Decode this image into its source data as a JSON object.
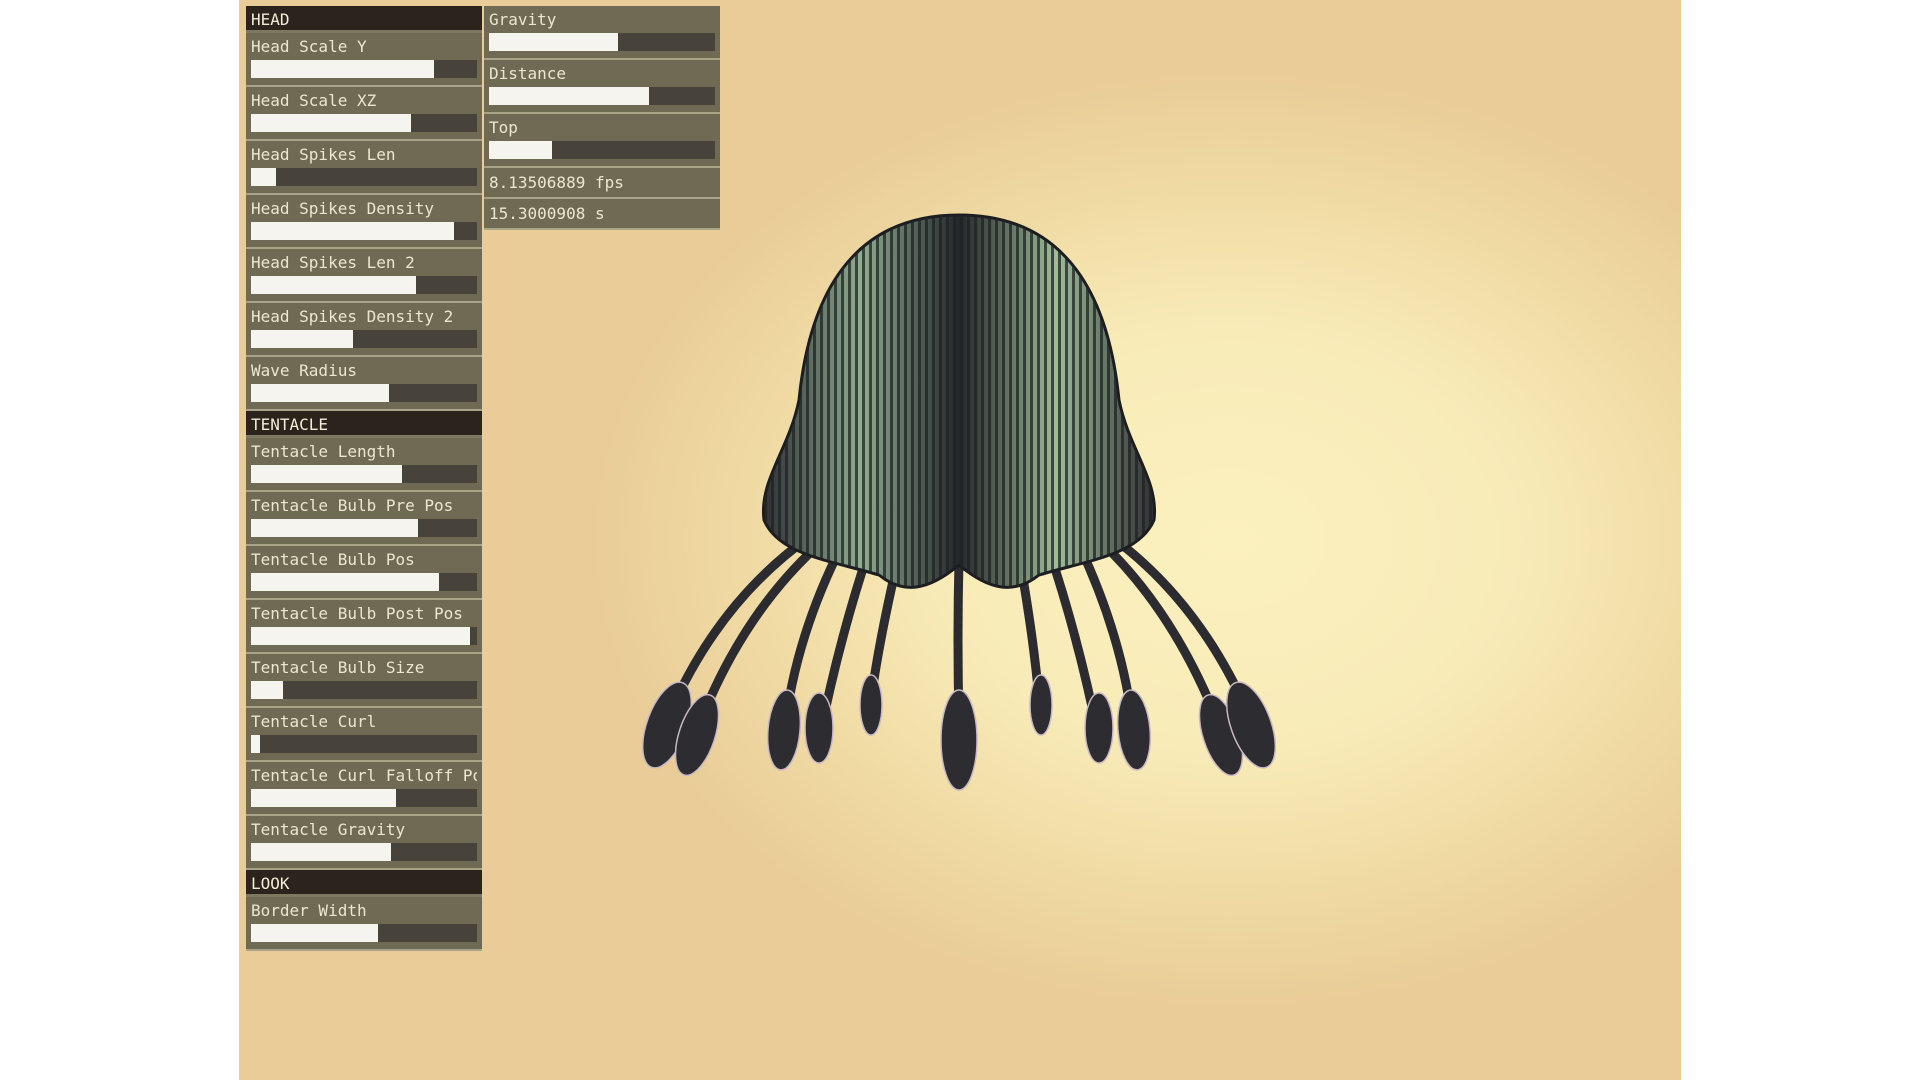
{
  "colors": {
    "panel_bg": "#6f6a54",
    "header_bg": "#2a241c",
    "track": "#47433a",
    "fill": "#f6f4ee",
    "background_center": "#fbf1bf",
    "background_edge": "#e9cc97",
    "jellyfish_dark": "#2f2f33",
    "jellyfish_light": "#a9c4a2"
  },
  "left_panel": {
    "sections": [
      {
        "title": "HEAD",
        "sliders": [
          {
            "label": "Head Scale Y",
            "value": 0.81
          },
          {
            "label": "Head Scale XZ",
            "value": 0.71
          },
          {
            "label": "Head Spikes Len",
            "value": 0.11
          },
          {
            "label": "Head Spikes Density",
            "value": 0.9
          },
          {
            "label": "Head Spikes Len 2",
            "value": 0.73
          },
          {
            "label": "Head Spikes Density 2",
            "value": 0.45
          },
          {
            "label": "Wave Radius",
            "value": 0.61
          }
        ]
      },
      {
        "title": "TENTACLE",
        "sliders": [
          {
            "label": "Tentacle Length",
            "value": 0.67
          },
          {
            "label": "Tentacle Bulb Pre Pos",
            "value": 0.74
          },
          {
            "label": "Tentacle Bulb Pos",
            "value": 0.83
          },
          {
            "label": "Tentacle Bulb Post Pos",
            "value": 0.97
          },
          {
            "label": "Tentacle Bulb Size",
            "value": 0.14
          },
          {
            "label": "Tentacle Curl",
            "value": 0.04
          },
          {
            "label": "Tentacle Curl Falloff Pos",
            "value": 0.64
          },
          {
            "label": "Tentacle Gravity",
            "value": 0.62
          }
        ]
      },
      {
        "title": "LOOK",
        "sliders": [
          {
            "label": "Border Width",
            "value": 0.56
          }
        ]
      }
    ]
  },
  "right_panel": {
    "sliders": [
      {
        "label": "Gravity",
        "value": 0.57
      },
      {
        "label": "Distance",
        "value": 0.71
      },
      {
        "label": "Top",
        "value": 0.28
      }
    ],
    "fps_text": "8.13506889 fps",
    "time_text": "15.3000908 s"
  }
}
